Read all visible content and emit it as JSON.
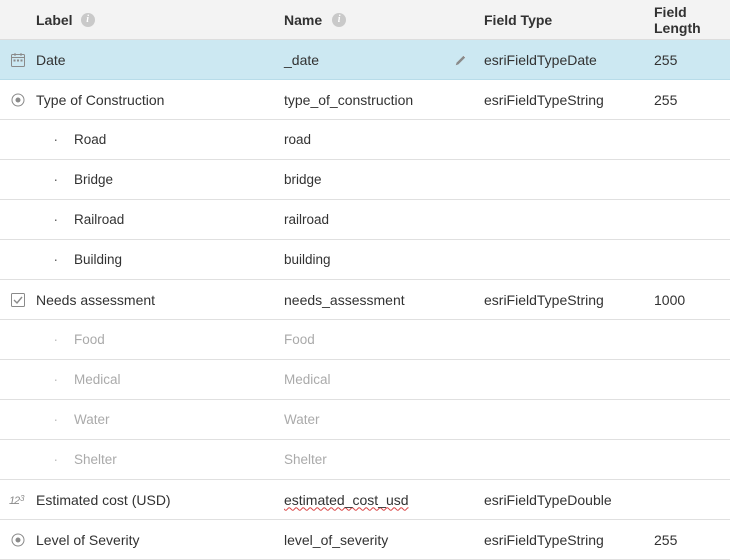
{
  "headers": {
    "label": "Label",
    "name": "Name",
    "type": "Field Type",
    "length": "Field Length"
  },
  "rows": [
    {
      "icon": "calendar",
      "label": "Date",
      "name": "_date",
      "type": "esriFieldTypeDate",
      "length": "255",
      "selected": true,
      "editIcon": true
    },
    {
      "icon": "radio",
      "label": "Type of Construction",
      "name": "type_of_construction",
      "type": "esriFieldTypeString",
      "length": "255",
      "children": [
        {
          "label": "Road",
          "name": "road"
        },
        {
          "label": "Bridge",
          "name": "bridge"
        },
        {
          "label": "Railroad",
          "name": "railroad"
        },
        {
          "label": "Building",
          "name": "building"
        }
      ]
    },
    {
      "icon": "checkbox",
      "label": "Needs assessment",
      "name": "needs_assessment",
      "type": "esriFieldTypeString",
      "length": "1000",
      "children": [
        {
          "label": "Food",
          "name": "Food",
          "muted": true
        },
        {
          "label": "Medical",
          "name": "Medical",
          "muted": true
        },
        {
          "label": "Water",
          "name": "Water",
          "muted": true
        },
        {
          "label": "Shelter",
          "name": "Shelter",
          "muted": true
        }
      ]
    },
    {
      "icon": "numeric",
      "label": "Estimated cost (USD)",
      "name": "estimated_cost_usd",
      "nameSquiggle": true,
      "type": "esriFieldTypeDouble",
      "length": ""
    },
    {
      "icon": "radio",
      "label": "Level of Severity",
      "name": "level_of_severity",
      "type": "esriFieldTypeString",
      "length": "255"
    }
  ]
}
